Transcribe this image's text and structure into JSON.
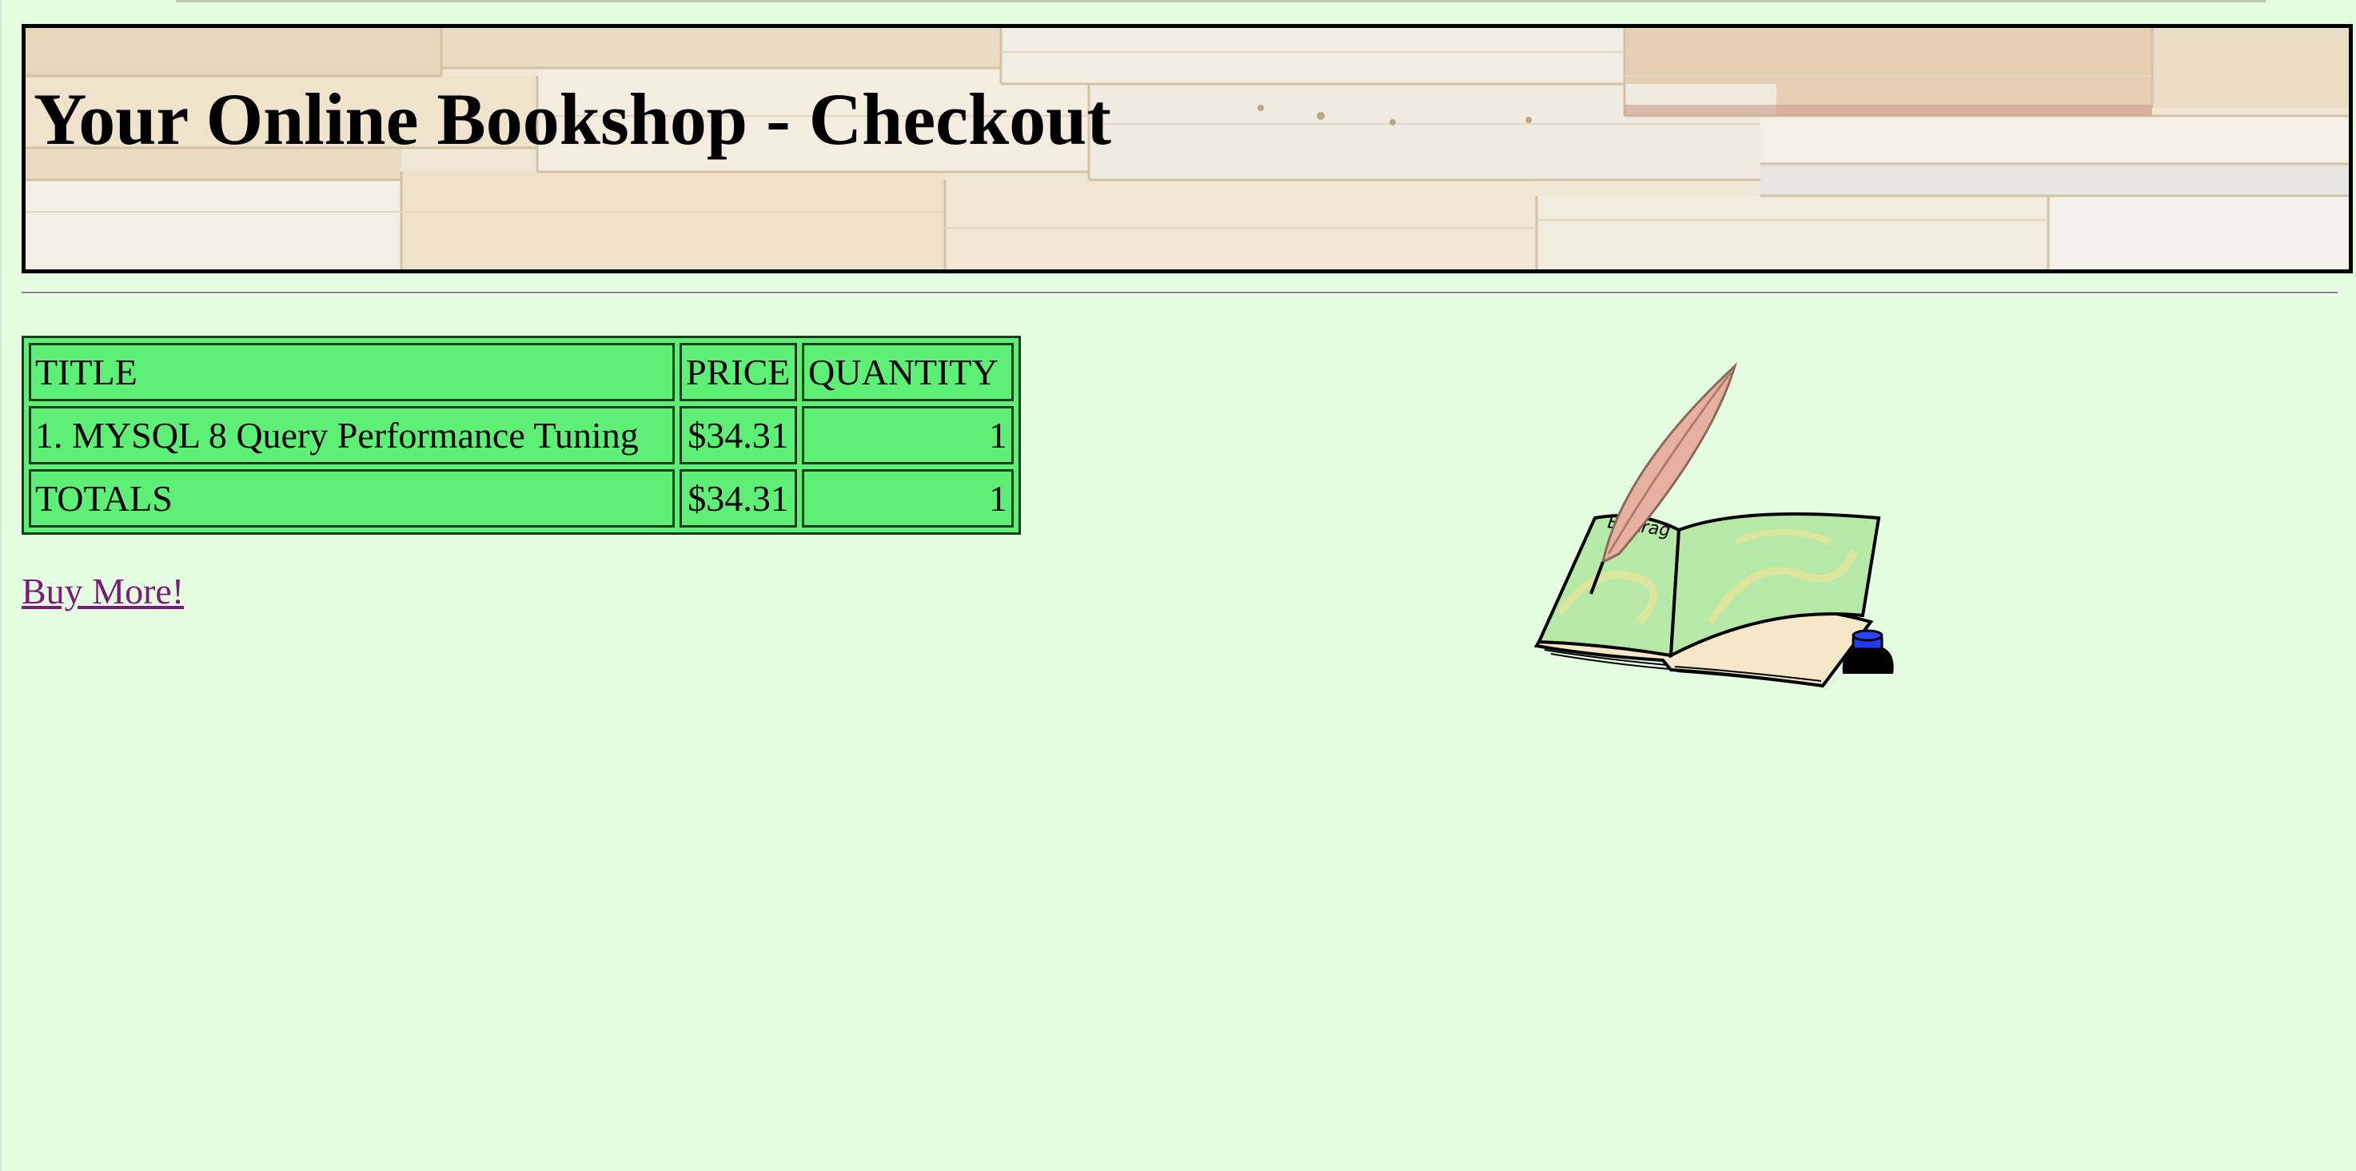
{
  "header": {
    "title": "Your Online Bookshop - Checkout"
  },
  "cart": {
    "columns": [
      "TITLE",
      "PRICE",
      "QUANTITY"
    ],
    "rows": [
      {
        "title": "1. MYSQL 8 Query Performance Tuning",
        "price": "$34.31",
        "quantity": "1"
      }
    ],
    "totals": {
      "label": "TOTALS",
      "price": "$34.31",
      "quantity": "1"
    }
  },
  "links": {
    "buy_more": "Buy More!"
  },
  "illustration": {
    "icon": "open-book-quill-ink-icon",
    "book_text": "Eintrag"
  },
  "colors": {
    "page_background": "#e4fde0",
    "table_background": "#5ef076",
    "link": "#7b1a7b"
  }
}
